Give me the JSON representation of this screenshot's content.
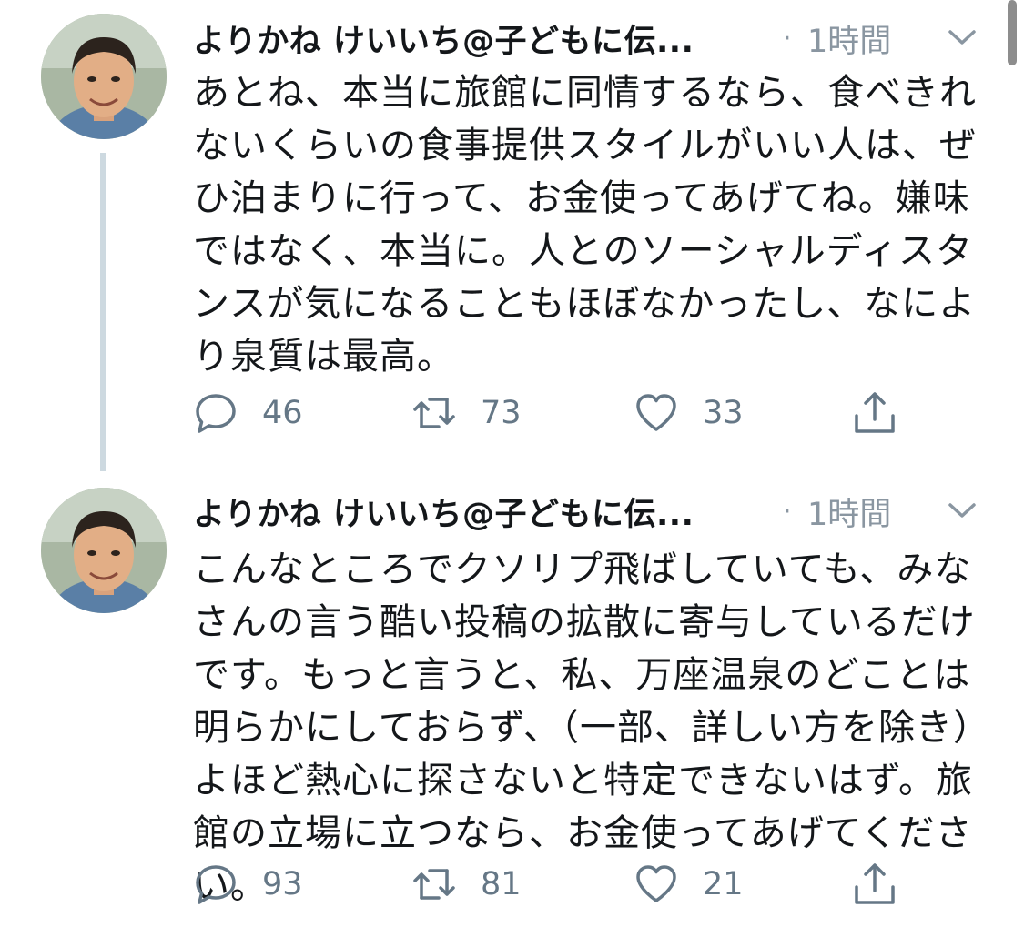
{
  "tweets": [
    {
      "display_name": "よりかね けいいち@子どもに伝...",
      "separator": "·",
      "timestamp": "1時間",
      "text": "あとね、本当に旅館に同情するなら、食べきれないくらいの食事提供スタイルがいい人は、ぜひ泊まりに行って、お金使ってあげてね。嫌味ではなく、本当に。人とのソーシャルディスタンスが気になることもほぼなかったし、なにより泉質は最高。",
      "replies": "46",
      "retweets": "73",
      "likes": "33"
    },
    {
      "display_name": "よりかね けいいち@子どもに伝...",
      "separator": "·",
      "timestamp": "1時間",
      "text": "こんなところでクソリプ飛ばしていても、みなさんの言う酷い投稿の拡散に寄与しているだけです。もっと言うと、私、万座温泉のどことは明らかにしておらず、（一部、詳しい方を除き）よほど熱心に探さないと特定できないはず。旅館の立場に立つなら、お金使ってあげてください。",
      "replies": "93",
      "retweets": "81",
      "likes": "21"
    }
  ],
  "icons": {
    "reply": "reply-icon",
    "retweet": "retweet-icon",
    "like": "heart-icon",
    "share": "share-icon",
    "menu": "chevron-down-icon"
  },
  "colors": {
    "text": "#14171a",
    "secondary": "#8a96a1",
    "action": "#657786",
    "thread_line": "#cdd9e0"
  }
}
